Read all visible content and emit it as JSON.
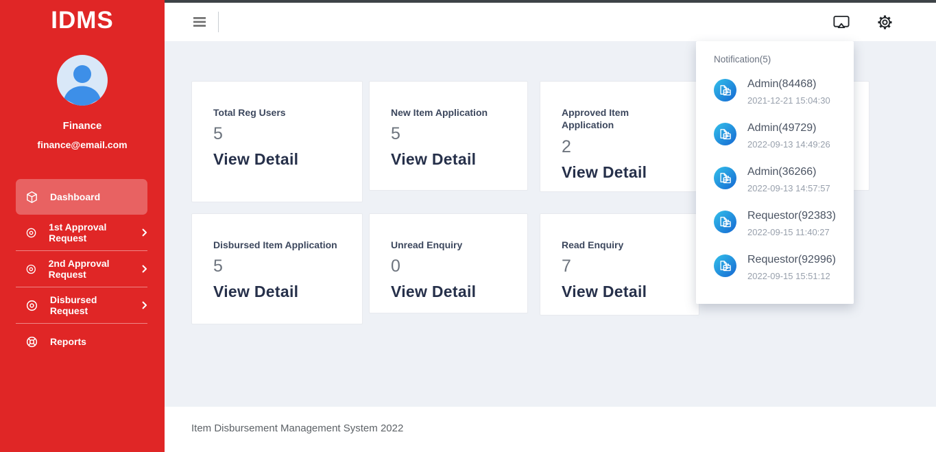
{
  "app": {
    "name": "IDMS",
    "footer": "Item Disbursement Management System 2022"
  },
  "user": {
    "name": "Finance",
    "email": "finance@email.com"
  },
  "sidebar": {
    "items": [
      {
        "label": "Dashboard",
        "icon": "cube-icon",
        "active": true
      },
      {
        "label": "1st Approval Request",
        "icon": "circle-dot-icon",
        "expandable": true
      },
      {
        "label": "2nd Approval Request",
        "icon": "circle-dot-icon",
        "expandable": true
      },
      {
        "label": "Disbursed Request",
        "icon": "circle-dot-icon",
        "expandable": true
      },
      {
        "label": "Reports",
        "icon": "lifebuoy-icon",
        "expandable": false
      }
    ]
  },
  "topbar": {
    "icons": [
      "menu-icon",
      "cast-icon",
      "gear-icon"
    ]
  },
  "cards": [
    {
      "title": "Total Reg Users",
      "value": "5",
      "link": "View Detail"
    },
    {
      "title": "New Item Application",
      "value": "5",
      "link": "View Detail"
    },
    {
      "title": "Approved Item Application",
      "value": "2",
      "link": "View Detail"
    },
    {
      "title": "Disbursed Item Application",
      "value": "5",
      "link": "View Detail"
    },
    {
      "title": "Unread Enquiry",
      "value": "0",
      "link": "View Detail"
    },
    {
      "title": "Read Enquiry",
      "value": "7",
      "link": "View Detail"
    }
  ],
  "notifications": {
    "header": "Notification(5)",
    "items": [
      {
        "title": "Admin(84468)",
        "time": "2021-12-21 15:04:30"
      },
      {
        "title": "Admin(49729)",
        "time": "2022-09-13 14:49:26"
      },
      {
        "title": "Admin(36266)",
        "time": "2022-09-13 14:57:57"
      },
      {
        "title": "Requestor(92383)",
        "time": "2022-09-15 11:40:27"
      },
      {
        "title": "Requestor(92996)",
        "time": "2022-09-15 15:51:12"
      }
    ]
  },
  "colors": {
    "sidebar_red": "#e02626",
    "accent_blue": "#3d8fe8",
    "notif_icon_gradient": [
      "#33c0ea",
      "#1567d2"
    ],
    "card_link": "#26304a",
    "content_bg": "#eef1f6"
  }
}
